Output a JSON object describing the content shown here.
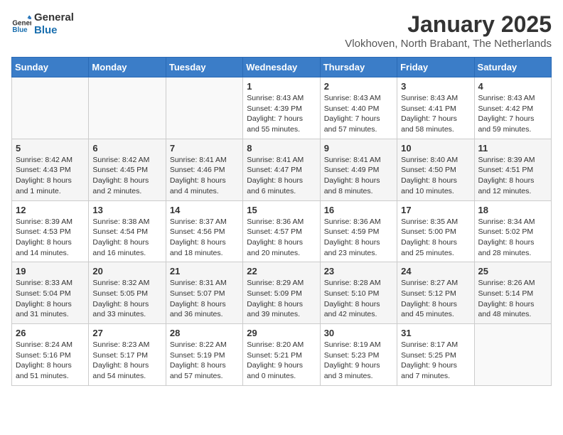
{
  "header": {
    "logo_line1": "General",
    "logo_line2": "Blue",
    "month": "January 2025",
    "location": "Vlokhoven, North Brabant, The Netherlands"
  },
  "days_of_week": [
    "Sunday",
    "Monday",
    "Tuesday",
    "Wednesday",
    "Thursday",
    "Friday",
    "Saturday"
  ],
  "weeks": [
    [
      {
        "day": "",
        "info": ""
      },
      {
        "day": "",
        "info": ""
      },
      {
        "day": "",
        "info": ""
      },
      {
        "day": "1",
        "info": "Sunrise: 8:43 AM\nSunset: 4:39 PM\nDaylight: 7 hours\nand 55 minutes."
      },
      {
        "day": "2",
        "info": "Sunrise: 8:43 AM\nSunset: 4:40 PM\nDaylight: 7 hours\nand 57 minutes."
      },
      {
        "day": "3",
        "info": "Sunrise: 8:43 AM\nSunset: 4:41 PM\nDaylight: 7 hours\nand 58 minutes."
      },
      {
        "day": "4",
        "info": "Sunrise: 8:43 AM\nSunset: 4:42 PM\nDaylight: 7 hours\nand 59 minutes."
      }
    ],
    [
      {
        "day": "5",
        "info": "Sunrise: 8:42 AM\nSunset: 4:43 PM\nDaylight: 8 hours\nand 1 minute."
      },
      {
        "day": "6",
        "info": "Sunrise: 8:42 AM\nSunset: 4:45 PM\nDaylight: 8 hours\nand 2 minutes."
      },
      {
        "day": "7",
        "info": "Sunrise: 8:41 AM\nSunset: 4:46 PM\nDaylight: 8 hours\nand 4 minutes."
      },
      {
        "day": "8",
        "info": "Sunrise: 8:41 AM\nSunset: 4:47 PM\nDaylight: 8 hours\nand 6 minutes."
      },
      {
        "day": "9",
        "info": "Sunrise: 8:41 AM\nSunset: 4:49 PM\nDaylight: 8 hours\nand 8 minutes."
      },
      {
        "day": "10",
        "info": "Sunrise: 8:40 AM\nSunset: 4:50 PM\nDaylight: 8 hours\nand 10 minutes."
      },
      {
        "day": "11",
        "info": "Sunrise: 8:39 AM\nSunset: 4:51 PM\nDaylight: 8 hours\nand 12 minutes."
      }
    ],
    [
      {
        "day": "12",
        "info": "Sunrise: 8:39 AM\nSunset: 4:53 PM\nDaylight: 8 hours\nand 14 minutes."
      },
      {
        "day": "13",
        "info": "Sunrise: 8:38 AM\nSunset: 4:54 PM\nDaylight: 8 hours\nand 16 minutes."
      },
      {
        "day": "14",
        "info": "Sunrise: 8:37 AM\nSunset: 4:56 PM\nDaylight: 8 hours\nand 18 minutes."
      },
      {
        "day": "15",
        "info": "Sunrise: 8:36 AM\nSunset: 4:57 PM\nDaylight: 8 hours\nand 20 minutes."
      },
      {
        "day": "16",
        "info": "Sunrise: 8:36 AM\nSunset: 4:59 PM\nDaylight: 8 hours\nand 23 minutes."
      },
      {
        "day": "17",
        "info": "Sunrise: 8:35 AM\nSunset: 5:00 PM\nDaylight: 8 hours\nand 25 minutes."
      },
      {
        "day": "18",
        "info": "Sunrise: 8:34 AM\nSunset: 5:02 PM\nDaylight: 8 hours\nand 28 minutes."
      }
    ],
    [
      {
        "day": "19",
        "info": "Sunrise: 8:33 AM\nSunset: 5:04 PM\nDaylight: 8 hours\nand 31 minutes."
      },
      {
        "day": "20",
        "info": "Sunrise: 8:32 AM\nSunset: 5:05 PM\nDaylight: 8 hours\nand 33 minutes."
      },
      {
        "day": "21",
        "info": "Sunrise: 8:31 AM\nSunset: 5:07 PM\nDaylight: 8 hours\nand 36 minutes."
      },
      {
        "day": "22",
        "info": "Sunrise: 8:29 AM\nSunset: 5:09 PM\nDaylight: 8 hours\nand 39 minutes."
      },
      {
        "day": "23",
        "info": "Sunrise: 8:28 AM\nSunset: 5:10 PM\nDaylight: 8 hours\nand 42 minutes."
      },
      {
        "day": "24",
        "info": "Sunrise: 8:27 AM\nSunset: 5:12 PM\nDaylight: 8 hours\nand 45 minutes."
      },
      {
        "day": "25",
        "info": "Sunrise: 8:26 AM\nSunset: 5:14 PM\nDaylight: 8 hours\nand 48 minutes."
      }
    ],
    [
      {
        "day": "26",
        "info": "Sunrise: 8:24 AM\nSunset: 5:16 PM\nDaylight: 8 hours\nand 51 minutes."
      },
      {
        "day": "27",
        "info": "Sunrise: 8:23 AM\nSunset: 5:17 PM\nDaylight: 8 hours\nand 54 minutes."
      },
      {
        "day": "28",
        "info": "Sunrise: 8:22 AM\nSunset: 5:19 PM\nDaylight: 8 hours\nand 57 minutes."
      },
      {
        "day": "29",
        "info": "Sunrise: 8:20 AM\nSunset: 5:21 PM\nDaylight: 9 hours\nand 0 minutes."
      },
      {
        "day": "30",
        "info": "Sunrise: 8:19 AM\nSunset: 5:23 PM\nDaylight: 9 hours\nand 3 minutes."
      },
      {
        "day": "31",
        "info": "Sunrise: 8:17 AM\nSunset: 5:25 PM\nDaylight: 9 hours\nand 7 minutes."
      },
      {
        "day": "",
        "info": ""
      }
    ]
  ]
}
